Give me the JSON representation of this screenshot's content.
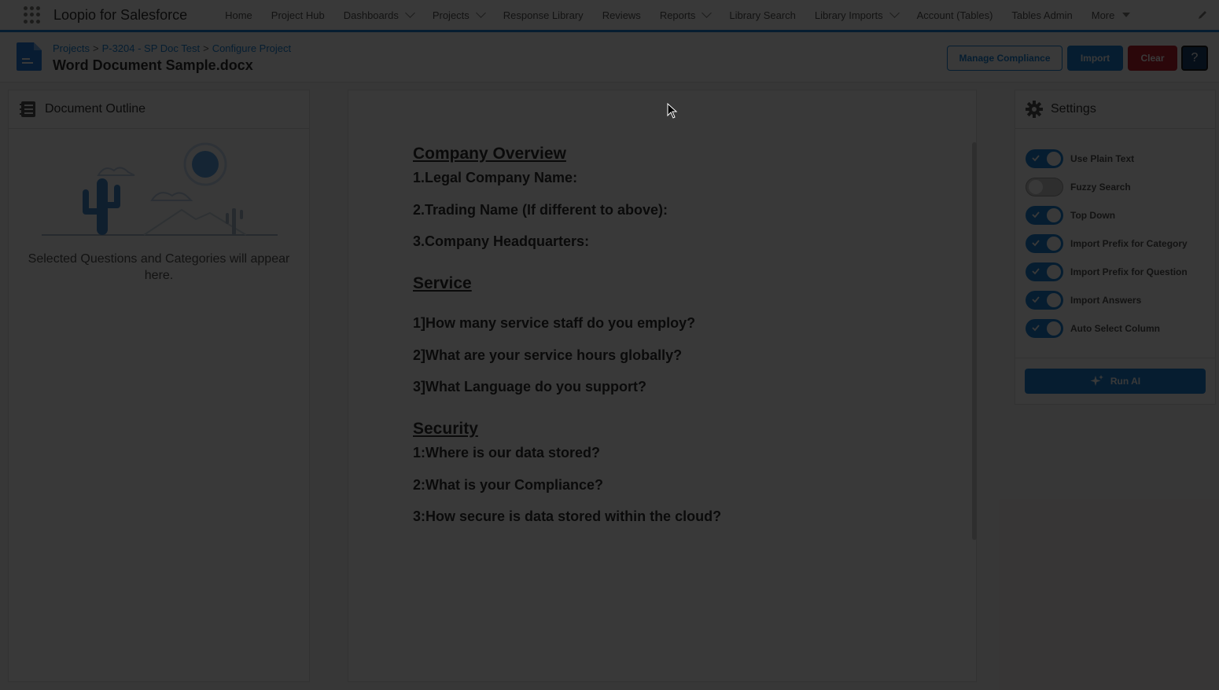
{
  "app": {
    "name": "Loopio for Salesforce"
  },
  "nav": {
    "items": [
      {
        "label": "Home",
        "dropdown": false
      },
      {
        "label": "Project Hub",
        "dropdown": false
      },
      {
        "label": "Dashboards",
        "dropdown": true
      },
      {
        "label": "Projects",
        "dropdown": true
      },
      {
        "label": "Response Library",
        "dropdown": false
      },
      {
        "label": "Reviews",
        "dropdown": false
      },
      {
        "label": "Reports",
        "dropdown": true
      },
      {
        "label": "Library Search",
        "dropdown": false
      },
      {
        "label": "Library Imports",
        "dropdown": true
      },
      {
        "label": "Account (Tables)",
        "dropdown": false
      },
      {
        "label": "Tables Admin",
        "dropdown": false
      },
      {
        "label": "More",
        "dropdown": "caret"
      }
    ]
  },
  "header": {
    "breadcrumb": [
      "Projects",
      "P-3204 - SP Doc Test",
      "Configure Project"
    ],
    "title": "Word Document Sample.docx",
    "buttons": {
      "manage_compliance": "Manage Compliance",
      "import": "Import",
      "clear": "Clear",
      "help": "?"
    }
  },
  "outline": {
    "title": "Document Outline",
    "empty_text": "Selected Questions and Categories will appear here."
  },
  "document": {
    "sections": [
      {
        "heading": "Company Overview",
        "lines": [
          "1.Legal Company Name:",
          "2.Trading Name (If different to above):",
          "3.Company Headquarters:"
        ]
      },
      {
        "heading": "Service",
        "lines": [
          "1]How many service staff do you employ?",
          "2]What are your service hours globally?",
          "3]What Language do you support?"
        ]
      },
      {
        "heading": "Security",
        "lines": [
          "1:Where is our data stored?",
          "2:What is your Compliance?",
          "3:How secure is data stored within the cloud?"
        ]
      }
    ]
  },
  "settings": {
    "title": "Settings",
    "toggles": [
      {
        "label": "Use Plain Text",
        "on": true
      },
      {
        "label": "Fuzzy Search",
        "on": false
      },
      {
        "label": "Top Down",
        "on": true
      },
      {
        "label": "Import Prefix for Category",
        "on": true
      },
      {
        "label": "Import Prefix for Question",
        "on": true
      },
      {
        "label": "Import Answers",
        "on": true
      },
      {
        "label": "Auto Select Column",
        "on": true
      }
    ],
    "run_ai_label": "Run AI"
  },
  "colors": {
    "brand_blue": "#0176d3",
    "clear_red": "#ba0517",
    "help_navy": "#032d60"
  }
}
